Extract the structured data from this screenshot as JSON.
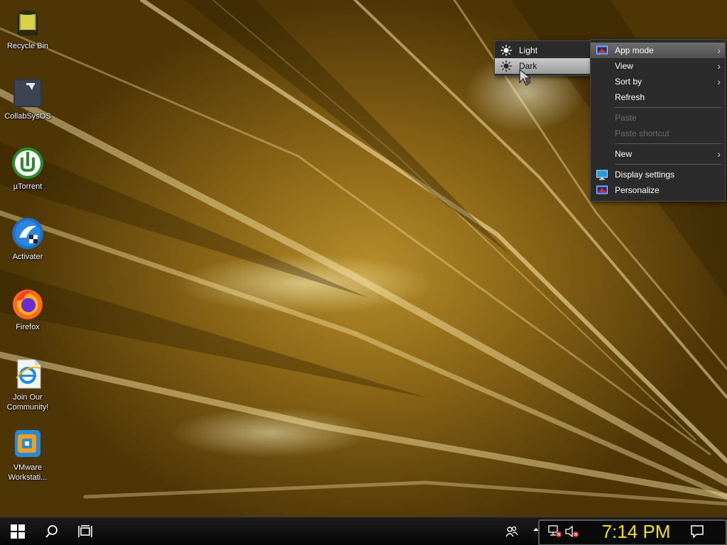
{
  "desktop": {
    "icons": [
      {
        "label": "Recycle Bin",
        "icon": "recycle-bin-icon"
      },
      {
        "label": "CollabSysOS",
        "icon": "folder-icon"
      },
      {
        "label": "µTorrent",
        "icon": "utorrent-icon"
      },
      {
        "label": "Activater",
        "icon": "activator-icon"
      },
      {
        "label": "Firefox",
        "icon": "firefox-icon"
      },
      {
        "label": "Join Our\nCommunity!",
        "icon": "internet-explorer-icon"
      },
      {
        "label": "VMware\nWorkstati...",
        "icon": "vmware-icon"
      }
    ]
  },
  "context_menu": {
    "items": [
      {
        "label": "App mode",
        "icon": "app-mode-icon",
        "submenu": true
      },
      {
        "label": "View",
        "submenu": true
      },
      {
        "label": "Sort by",
        "submenu": true
      },
      {
        "label": "Refresh"
      },
      {
        "label": "Paste",
        "disabled": true
      },
      {
        "label": "Paste shortcut",
        "disabled": true
      },
      {
        "label": "New",
        "submenu": true
      },
      {
        "label": "Display settings",
        "icon": "display-settings-icon"
      },
      {
        "label": "Personalize",
        "icon": "personalize-icon"
      }
    ]
  },
  "app_mode_submenu": {
    "items": [
      {
        "label": "Light",
        "icon": "sun-icon"
      },
      {
        "label": "Dark",
        "icon": "sun-icon",
        "selected": true
      }
    ]
  },
  "taskbar": {
    "clock": "7:14 PM",
    "accent": "#f2e200"
  }
}
